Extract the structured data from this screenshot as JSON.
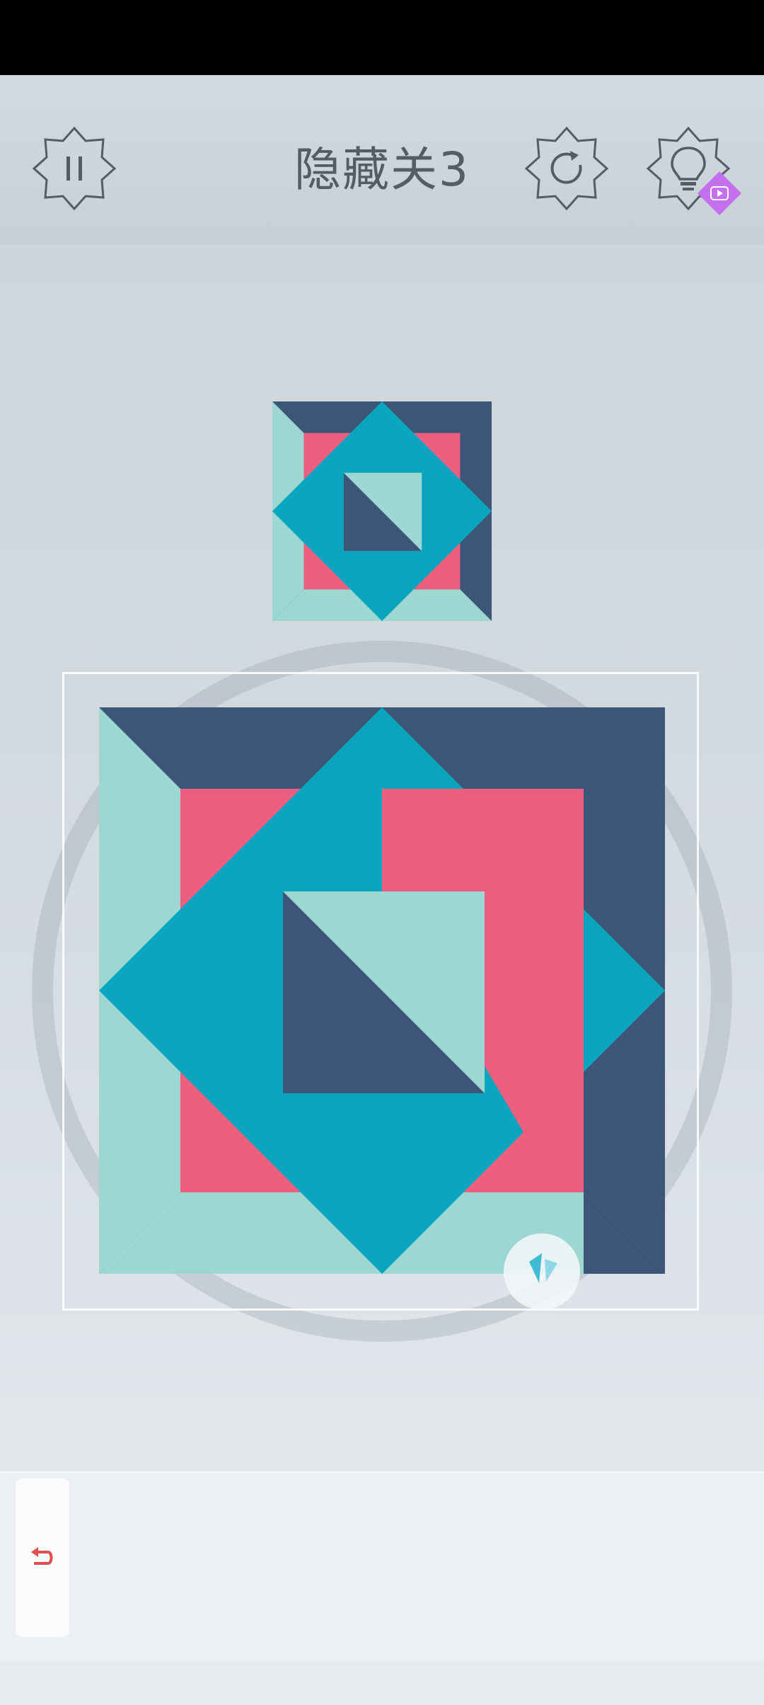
{
  "header": {
    "level_title": "隐藏关3"
  },
  "icons": {
    "pause": "pause-icon",
    "restart": "restart-icon",
    "hint": "lightbulb-icon",
    "hint_badge": "video-ad-icon",
    "rotate": "rotate-icon",
    "undo": "undo-icon"
  },
  "colors": {
    "navy": "#3d5577",
    "teal": "#0ba5bf",
    "mint": "#9dd7d2",
    "pink": "#ee5e7e",
    "badge_purple": "#c470ee",
    "undo_red": "#e05050",
    "icon_gray": "#555c63"
  }
}
